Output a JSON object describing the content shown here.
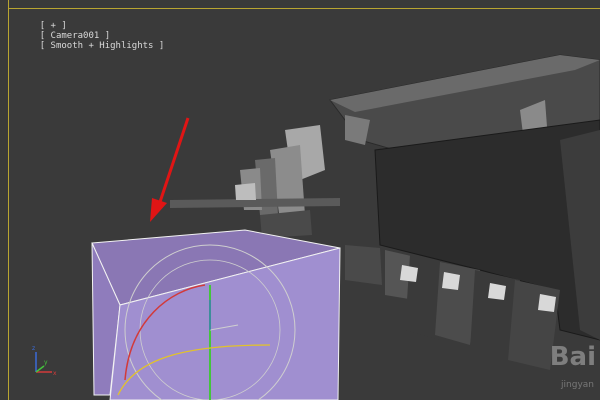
{
  "viewport": {
    "label_parts": [
      "[ + ]",
      "[ Camera001 ]",
      "[ Smooth + Highlights ]"
    ]
  },
  "watermark": {
    "text": "Bai",
    "sub": "jingyan"
  },
  "colors": {
    "viewport_bg": "#3a3a3a",
    "active_frame": "#b9a531",
    "selected_box": "#9a87c8",
    "arrow": "#e01515",
    "gizmo_circle": "#cfcfcf",
    "rotate_red": "#d23a3a",
    "rotate_green": "#44c43c",
    "rotate_yellow": "#e2c22b"
  },
  "icons": [
    "arrow-annotation-icon",
    "axis-tripod-icon",
    "rotate-gizmo-icon"
  ]
}
